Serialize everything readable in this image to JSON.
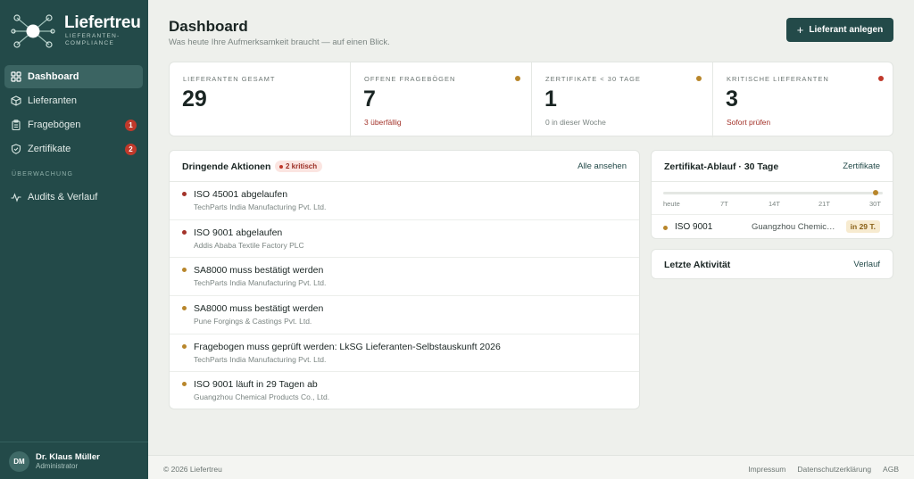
{
  "brand": {
    "name": "Liefertreu",
    "tagline": "LIEFERANTEN-COMPLIANCE"
  },
  "sidebar": {
    "items": [
      {
        "label": "Dashboard",
        "icon": "grid-icon",
        "active": true
      },
      {
        "label": "Lieferanten",
        "icon": "box-icon"
      },
      {
        "label": "Fragebögen",
        "icon": "clipboard-icon",
        "badge": "1"
      },
      {
        "label": "Zertifikate",
        "icon": "shield-check-icon",
        "badge": "2"
      }
    ],
    "section_label": "ÜBERWACHUNG",
    "section_items": [
      {
        "label": "Audits & Verlauf",
        "icon": "activity-icon"
      }
    ]
  },
  "user": {
    "initials": "DM",
    "name": "Dr. Klaus Müller",
    "role": "Administrator"
  },
  "header": {
    "title": "Dashboard",
    "subtitle": "Was heute Ihre Aufmerksamkeit braucht — auf einen Blick.",
    "primary_button": "Lieferant anlegen"
  },
  "stats": [
    {
      "label": "LIEFERANTEN GESAMT",
      "value": "29",
      "sub": "",
      "dot": ""
    },
    {
      "label": "OFFENE FRAGEBÖGEN",
      "value": "7",
      "sub": "3 überfällig",
      "sub_color": "#a3332a",
      "dot": "#b8862b"
    },
    {
      "label": "ZERTIFIKATE < 30 TAGE",
      "value": "1",
      "sub": "0 in dieser Woche",
      "sub_color": "#7b8582",
      "dot": "#b8862b"
    },
    {
      "label": "KRITISCHE LIEFERANTEN",
      "value": "3",
      "sub": "Sofort prüfen",
      "sub_color": "#a3332a",
      "dot": "#c0392b"
    }
  ],
  "actions": {
    "title": "Dringende Aktionen",
    "badge": "2 kritisch",
    "link": "Alle ansehen",
    "items": [
      {
        "title": "ISO 45001 abgelaufen",
        "supplier": "TechParts India Manufacturing Pvt. Ltd.",
        "severity_color": "#a3332a"
      },
      {
        "title": "ISO 9001 abgelaufen",
        "supplier": "Addis Ababa Textile Factory PLC",
        "severity_color": "#a3332a"
      },
      {
        "title": "SA8000 muss bestätigt werden",
        "supplier": "TechParts India Manufacturing Pvt. Ltd.",
        "severity_color": "#b8862b"
      },
      {
        "title": "SA8000 muss bestätigt werden",
        "supplier": "Pune Forgings & Castings Pvt. Ltd.",
        "severity_color": "#b8862b"
      },
      {
        "title": "Fragebogen muss geprüft werden: LkSG Lieferanten-Selbstauskunft 2026",
        "supplier": "TechParts India Manufacturing Pvt. Ltd.",
        "severity_color": "#b8862b"
      },
      {
        "title": "ISO 9001 läuft in 29 Tagen ab",
        "supplier": "Guangzhou Chemical Products Co., Ltd.",
        "severity_color": "#b8862b"
      }
    ]
  },
  "cert_expiry": {
    "title": "Zertifikat-Ablauf · 30 Tage",
    "link": "Zertifikate",
    "ticks": [
      "heute",
      "7T",
      "14T",
      "21T",
      "30T"
    ],
    "marker_day": 29,
    "range_days": 30,
    "rows": [
      {
        "name": "ISO 9001",
        "supplier": "Guangzhou Chemical Products Co., Ltd.",
        "days": "in 29 T."
      }
    ]
  },
  "activity": {
    "title": "Letzte Aktivität",
    "link": "Verlauf"
  },
  "footer": {
    "copyright": "© 2026 Liefertreu",
    "links": [
      "Impressum",
      "Datenschutzerklärung",
      "AGB"
    ]
  }
}
